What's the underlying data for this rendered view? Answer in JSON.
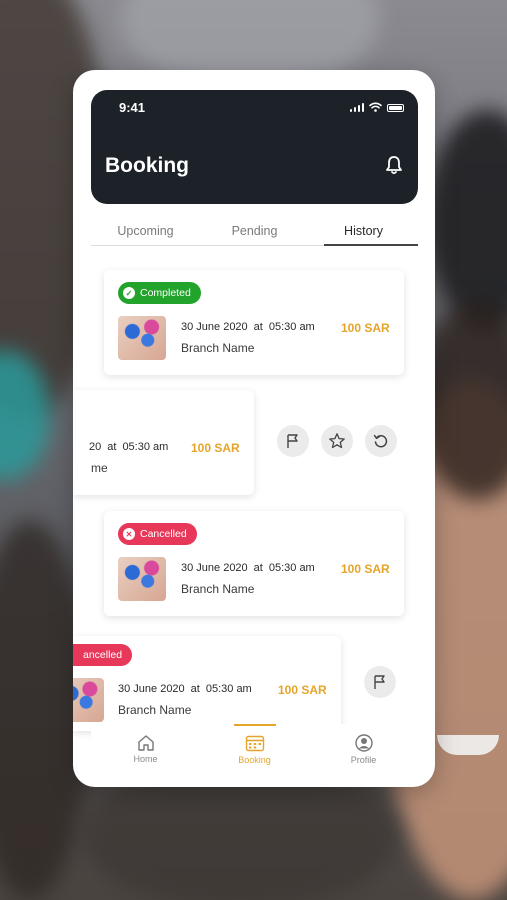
{
  "status_bar": {
    "time": "9:41"
  },
  "header": {
    "title": "Booking"
  },
  "tabs": [
    {
      "label": "Upcoming",
      "active": false
    },
    {
      "label": "Pending",
      "active": false
    },
    {
      "label": "History",
      "active": true
    }
  ],
  "bookings": [
    {
      "status": "Completed",
      "status_color": "#22a32b",
      "date": "30 June 2020",
      "at": "at",
      "time": "05:30 am",
      "price": "100 SAR",
      "branch": "Branch Name"
    },
    {
      "status": "",
      "date_partial": "20",
      "at": "at",
      "time": "05:30 am",
      "price": "100 SAR",
      "branch_partial": "me",
      "swiped": true
    },
    {
      "status": "Cancelled",
      "status_color": "#e8385a",
      "date": "30 June 2020",
      "at": "at",
      "time": "05:30 am",
      "price": "100 SAR",
      "branch": "Branch Name"
    },
    {
      "status_partial": "ancelled",
      "status_color": "#e8385a",
      "date": "30 June 2020",
      "at": "at",
      "time": "05:30 am",
      "price": "100 SAR",
      "branch": "Branch Name",
      "swiped": true
    }
  ],
  "swipe_actions": [
    {
      "icon": "flag-icon"
    },
    {
      "icon": "star-icon"
    },
    {
      "icon": "refresh-icon"
    }
  ],
  "bottom_nav": [
    {
      "label": "Home",
      "icon": "home-icon",
      "active": false
    },
    {
      "label": "Booking",
      "icon": "calendar-icon",
      "active": true
    },
    {
      "label": "Profile",
      "icon": "profile-icon",
      "active": false
    }
  ],
  "colors": {
    "accent": "#e5a52a",
    "header_bg": "#1c2228",
    "completed": "#22a32b",
    "cancelled": "#e8385a"
  }
}
